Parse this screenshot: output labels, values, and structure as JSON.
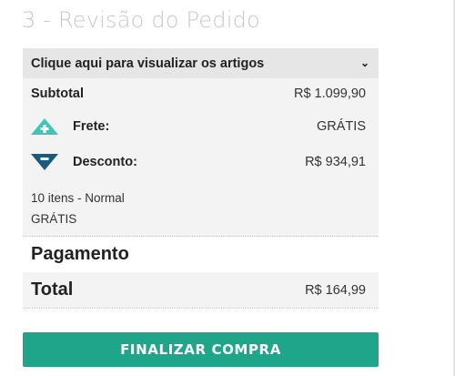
{
  "step_title": "3 - Revisão do Pedido",
  "summary": {
    "toggle_label": "Clique aqui para visualizar os artigos",
    "toggle_icon": "chevron-down-icon",
    "subtotal": {
      "label": "Subtotal",
      "value": "R$ 1.099,90"
    },
    "frete": {
      "label": "Frete:",
      "value": "GRÁTIS",
      "icon": "plus-icon"
    },
    "desconto": {
      "label": "Desconto:",
      "value": "R$ 934,91",
      "icon": "minus-icon"
    },
    "shipping_line1": "10 itens - Normal",
    "shipping_line2": "GRÁTIS"
  },
  "pagamento_heading": "Pagamento",
  "total": {
    "label": "Total",
    "value": "R$ 164,99"
  },
  "finalize_button": "FINALIZAR COMPRA",
  "colors": {
    "accent": "#1fa589",
    "plus_icon": "#3cc6b5",
    "minus_icon": "#1b5a7d"
  }
}
